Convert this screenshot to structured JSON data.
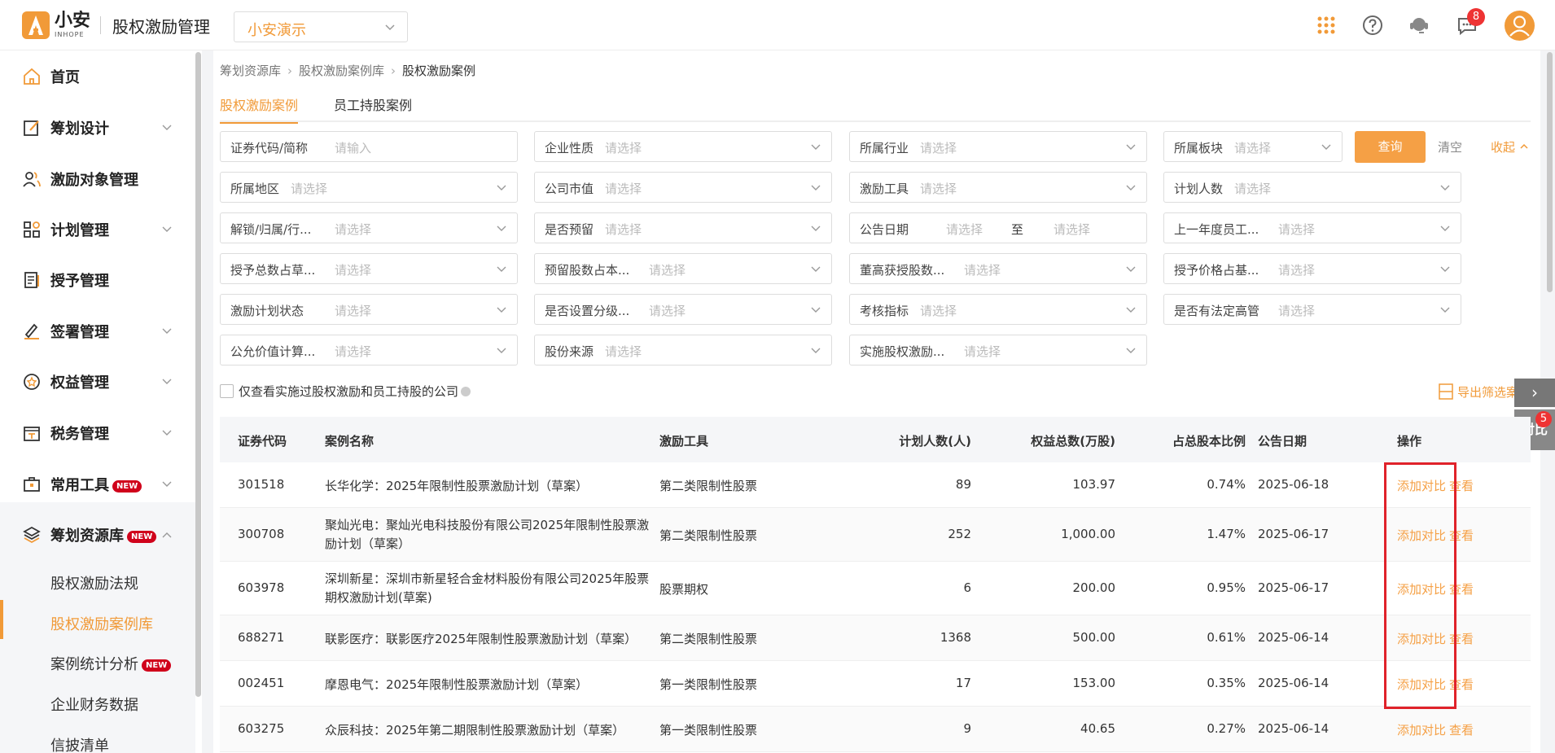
{
  "header": {
    "logo_main": "小安",
    "logo_sub": "INHOPE",
    "app_title": "股权激励管理",
    "company": "小安演示",
    "message_badge": "8"
  },
  "sidebar": {
    "items": [
      {
        "label": "首页",
        "icon": "home-icon"
      },
      {
        "label": "筹划设计",
        "icon": "edit-icon"
      },
      {
        "label": "激励对象管理",
        "icon": "users-icon"
      },
      {
        "label": "计划管理",
        "icon": "grid-icon"
      },
      {
        "label": "授予管理",
        "icon": "document-icon"
      },
      {
        "label": "签署管理",
        "icon": "sign-icon"
      },
      {
        "label": "权益管理",
        "icon": "badge-icon"
      },
      {
        "label": "税务管理",
        "icon": "tax-icon"
      },
      {
        "label": "常用工具",
        "icon": "toolbox-icon",
        "tag": "NEW"
      },
      {
        "label": "筹划资源库",
        "icon": "layers-icon",
        "tag": "NEW"
      }
    ],
    "sub_items": [
      {
        "label": "股权激励法规"
      },
      {
        "label": "股权激励案例库"
      },
      {
        "label": "案例统计分析",
        "tag": "NEW"
      },
      {
        "label": "企业财务数据"
      },
      {
        "label": "信披清单"
      }
    ]
  },
  "breadcrumb": [
    "筹划资源库",
    "股权激励案例库",
    "股权激励案例"
  ],
  "tabs": [
    "股权激励案例",
    "员工持股案例"
  ],
  "filters": [
    {
      "label": "证券代码/简称",
      "placeholder": "请输入"
    },
    {
      "label": "企业性质",
      "placeholder": "请选择"
    },
    {
      "label": "所属行业",
      "placeholder": "请选择"
    },
    {
      "label": "所属板块",
      "placeholder": "请选择"
    },
    {
      "label": "所属地区",
      "placeholder": "请选择"
    },
    {
      "label": "公司市值",
      "placeholder": "请选择"
    },
    {
      "label": "激励工具",
      "placeholder": "请选择"
    },
    {
      "label": "计划人数",
      "placeholder": "请选择"
    },
    {
      "label": "解锁/归属/行...",
      "placeholder": "请选择"
    },
    {
      "label": "是否预留",
      "placeholder": "请选择"
    },
    {
      "label": "公告日期",
      "placeholder": "请选择",
      "to": "至",
      "placeholder2": "请选择"
    },
    {
      "label": "上一年度员工...",
      "placeholder": "请选择"
    },
    {
      "label": "授予总数占草...",
      "placeholder": "请选择"
    },
    {
      "label": "预留股数占本...",
      "placeholder": "请选择"
    },
    {
      "label": "董高获授股数...",
      "placeholder": "请选择"
    },
    {
      "label": "授予价格占基...",
      "placeholder": "请选择"
    },
    {
      "label": "激励计划状态",
      "placeholder": "请选择"
    },
    {
      "label": "是否设置分级...",
      "placeholder": "请选择"
    },
    {
      "label": "考核指标",
      "placeholder": "请选择"
    },
    {
      "label": "是否有法定高管",
      "placeholder": "请选择"
    },
    {
      "label": "公允价值计算...",
      "placeholder": "请选择"
    },
    {
      "label": "股份来源",
      "placeholder": "请选择"
    },
    {
      "label": "实施股权激励...",
      "placeholder": "请选择"
    }
  ],
  "actions": {
    "query": "查询",
    "clear": "清空",
    "collapse": "收起",
    "checkbox_label": "仅查看实施过股权激励和员工持股的公司",
    "export": "导出筛选案例",
    "compare": "对比",
    "compare_badge": "5"
  },
  "table": {
    "headers": [
      "证券代码",
      "案例名称",
      "激励工具",
      "计划人数(人)",
      "权益总数(万股)",
      "占总股本比例",
      "公告日期",
      "操作"
    ],
    "rows": [
      {
        "code": "301518",
        "name": "长华化学：2025年限制性股票激励计划（草案）",
        "tool": "第二类限制性股票",
        "people": "89",
        "total": "103.97",
        "ratio": "0.74%",
        "date": "2025-06-18"
      },
      {
        "code": "300708",
        "name": "聚灿光电：聚灿光电科技股份有限公司2025年限制性股票激励计划（草案）",
        "tool": "第二类限制性股票",
        "people": "252",
        "total": "1,000.00",
        "ratio": "1.47%",
        "date": "2025-06-17"
      },
      {
        "code": "603978",
        "name": "深圳新星：深圳市新星轻合金材料股份有限公司2025年股票期权激励计划(草案)",
        "tool": "股票期权",
        "people": "6",
        "total": "200.00",
        "ratio": "0.95%",
        "date": "2025-06-17"
      },
      {
        "code": "688271",
        "name": "联影医疗：联影医疗2025年限制性股票激励计划（草案）",
        "tool": "第二类限制性股票",
        "people": "1368",
        "total": "500.00",
        "ratio": "0.61%",
        "date": "2025-06-14"
      },
      {
        "code": "002451",
        "name": "摩恩电气：2025年限制性股票激励计划（草案）",
        "tool": "第一类限制性股票",
        "people": "17",
        "total": "153.00",
        "ratio": "0.35%",
        "date": "2025-06-14"
      },
      {
        "code": "603275",
        "name": "众辰科技：2025年第二期限制性股票激励计划（草案）",
        "tool": "第一类限制性股票",
        "people": "9",
        "total": "40.65",
        "ratio": "0.27%",
        "date": "2025-06-14"
      }
    ],
    "op_add": "添加对比",
    "op_view": "查看"
  }
}
